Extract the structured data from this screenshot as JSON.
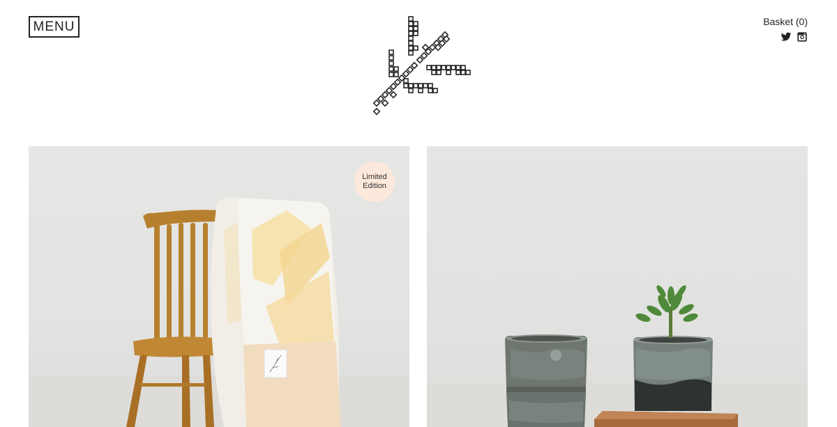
{
  "header": {
    "menu_label": "MENU",
    "basket_label": "Basket (0)",
    "logo_icon": "cross-stitch-logo-icon",
    "social": [
      {
        "name": "twitter-icon"
      },
      {
        "name": "instagram-icon"
      }
    ]
  },
  "products": [
    {
      "name": "blanket-on-chair-product",
      "badge": {
        "line1": "Limited",
        "line2": "Edition"
      },
      "badge_color": "#fde8dc"
    },
    {
      "name": "ceramic-planters-product"
    }
  ]
}
